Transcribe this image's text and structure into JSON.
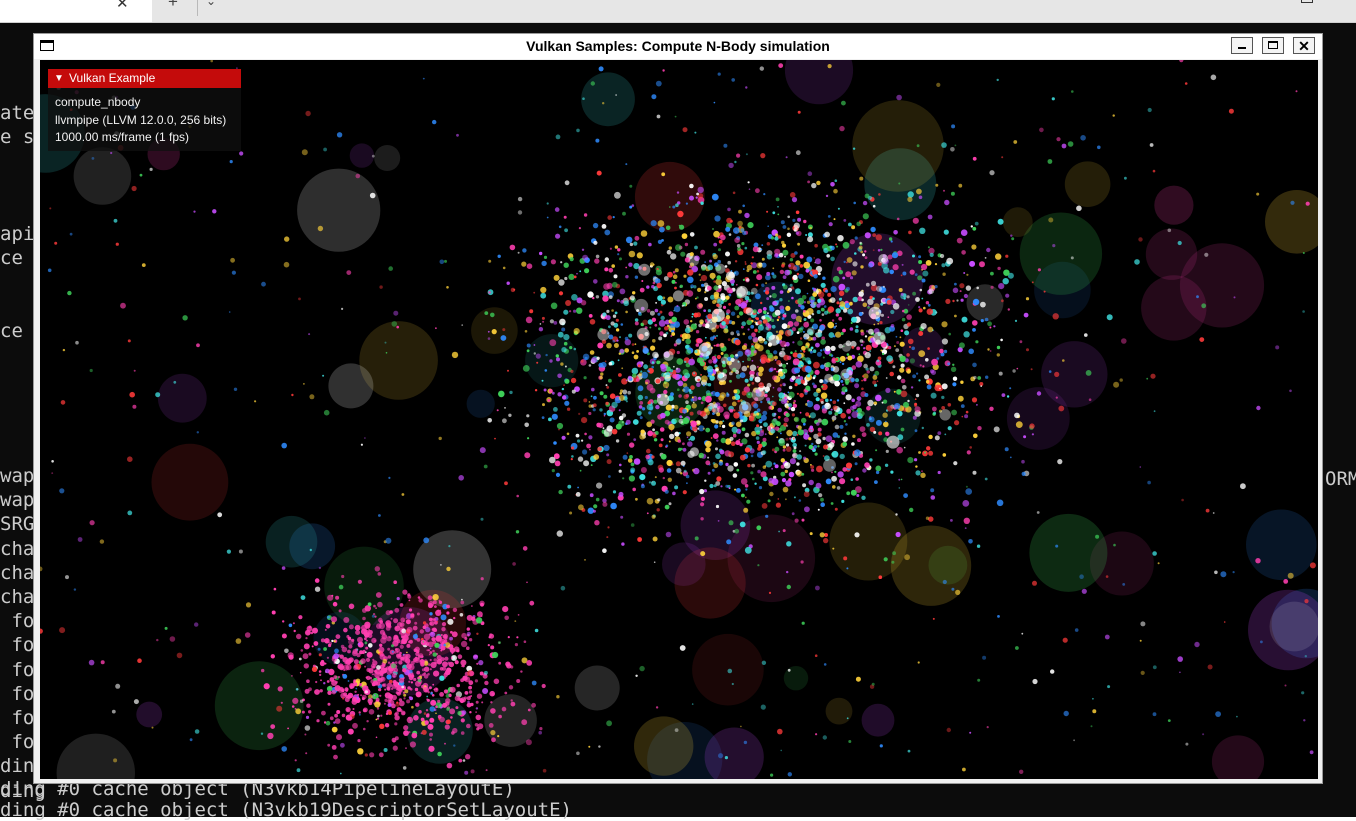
{
  "host": {
    "tab_close": "✕",
    "tab_new": "+",
    "tab_dropdown": "⌄",
    "terminal_lines_left": [
      "ated",
      "e su",
      "",
      "",
      "",
      "api",
      "ce s",
      "",
      "",
      "ce s",
      "",
      "",
      "",
      "",
      "",
      "wape",
      "wape",
      "SRGE",
      "char",
      "char",
      "char",
      " fo",
      " fo",
      " fo",
      " fo",
      " fo",
      " fo",
      "ding",
      "ding"
    ],
    "terminal_right_fragment": "ORM",
    "terminal_bottom_lines": [
      "ding #0 cache object (N3vkb14PipelineLayoutE)",
      "ding #0 cache object (N3vkb19DescriptorSetLayoutE)"
    ]
  },
  "window": {
    "title": "Vulkan Samples: Compute N-Body simulation",
    "minimize_icon": "minimize-icon",
    "maximize_icon": "maximize-icon",
    "close_icon": "close-icon",
    "close_glyph": "✕"
  },
  "overlay": {
    "header_arrow": "▼",
    "header": "Vulkan Example",
    "sample_name": "compute_nbody",
    "device": "llvmpipe (LLVM 12.0.0, 256 bits)",
    "frame_stats": "1000.00 ms/frame (1 fps)",
    "header_color": "#c40b0b"
  },
  "colors": {
    "particle_palette": [
      "#ff3fb0",
      "#ffd23a",
      "#3fd25a",
      "#2f8cff",
      "#ff3a3a",
      "#c84dff",
      "#ffffff",
      "#3fe0e0"
    ]
  }
}
